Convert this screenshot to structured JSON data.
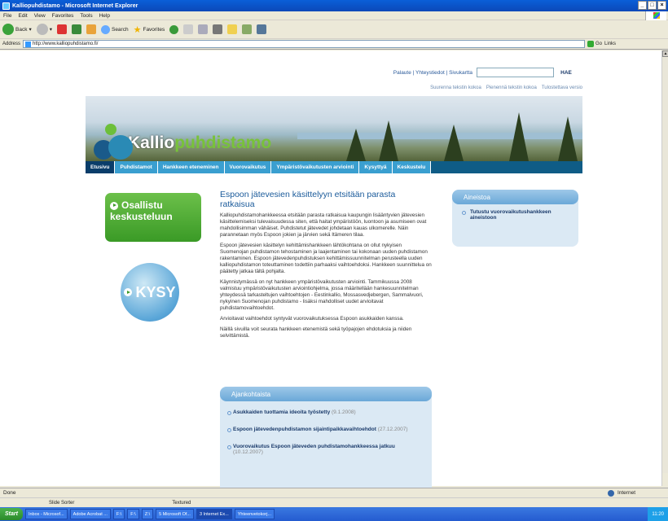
{
  "window": {
    "title": "Kalliopuhdistamo - Microsoft Internet Explorer"
  },
  "menu": [
    "File",
    "Edit",
    "View",
    "Favorites",
    "Tools",
    "Help"
  ],
  "toolbar": {
    "back": "Back",
    "search": "Search",
    "favorites": "Favorites"
  },
  "address": {
    "label": "Address",
    "url": "http://www.kalliopuhdistamo.fi/",
    "go": "Go",
    "links": "Links"
  },
  "site": {
    "util_links": "Palaute | Yhteystiedot | Sivukartta",
    "search_button": "HAE",
    "text_size_larger": "Suurenna tekstin kokoa",
    "text_size_smaller": "Pienennä tekstin kokoa",
    "print": "Tulostettava versio",
    "logo_a": "Kallio",
    "logo_b": "puhdistamo",
    "nav": [
      "Etusivu",
      "Puhdistamot",
      "Hankkeen eteneminen",
      "Vuorovaikutus",
      "Ympäristövaikutusten arviointi",
      "Kysyttyä",
      "Keskustelu"
    ],
    "btn_osallistu_1": "Osallistu",
    "btn_osallistu_2": "keskusteluun",
    "btn_kysy": "KYSY",
    "headline": "Espoon jätevesien käsittelyyn etsitään parasta ratkaisua",
    "paragraphs": [
      "Kalliopuhdistamohankkeessa etsitään parasta ratkaisua kaupungin lisääntyvien jätevesien käsittelemiseksi tulevaisuudessa siten, että haitat ympäristöön, luontoon ja asumiseen ovat mahdollisimman vähäiset. Puhdistetut jätevedet johdetaan kauas ulkomerelle. Näin parannetaan myös Espoon jokien ja järvien sekä Itämeren tilaa.",
      "Espoon jätevesien käsittelyn kehittämishankkeen lähtökohtana on ollut nykyisen Suomenojan puhdistamon tehostaminen ja laajentaminen tai kokonaan uuden puhdistamon rakentaminen. Espoon jätevedenpuhdistuksen kehittämissuunnitelman perusteella uuden kalliopuhdistamon toteuttaminen todettiin parhaaksi vaihtoehdoksi. Hankkeen suunnittelua on päätetty jatkaa tältä pohjalta.",
      "Käynnistymässä on nyt hankkeen ympäristövaikutusten arviointi. Tammikuussa 2008 valmistuu ympäristövaikutusten arviointiohjelma, jossa määritellään hankesuunnitelman yhteydessä tarkasteltujen vaihtoehtojen - Eestinkallio, Mossasvedjebergen, Sammalvuori, nykyinen Suomenojan puhdistamo - lisäksi mahdolliset uudet arvioitavat puhdistamovaihtoehdot.",
      "Arvioitavat vaihtoehdot syntyvät vuorovaikutuksessa Espoon asukkaiden kanssa.",
      "Näillä sivuilla voit seurata hankkeen etenemistä sekä työpajojen ehdotuksia ja niiden selvittämistä."
    ],
    "ajankohtaista": {
      "title": "Ajankohtaista",
      "items": [
        {
          "text": "Asukkaiden tuottamia ideoita työstetty",
          "date": "(9.1.2008)"
        },
        {
          "text": "Espoon jätevedenpuhdistamon sijaintipaikkavaihtoehdot",
          "date": "(27.12.2007)"
        },
        {
          "text": "Vuorovaikutus Espoon jäteveden puhdistamohankkeessa jatkuu",
          "date": "(10.12.2007)"
        }
      ]
    },
    "aineisto": {
      "title": "Aineistoa",
      "item": "Tutustu vuorovaikutushankkeen aineistoon"
    }
  },
  "status": {
    "left": "Done",
    "zone": "Internet"
  },
  "appbar": {
    "left": "Slide Sorter",
    "mid": "Textured"
  },
  "taskbar": {
    "start": "Start",
    "tasks": [
      "Inbox - Microsof...",
      "Adobe Acrobat ...",
      "F:\\",
      "F:\\",
      "Z:\\",
      "5 Microsoft Of...",
      "3 Internet Ex...",
      "Yhteenvetokorj..."
    ],
    "clock": "11:20"
  }
}
